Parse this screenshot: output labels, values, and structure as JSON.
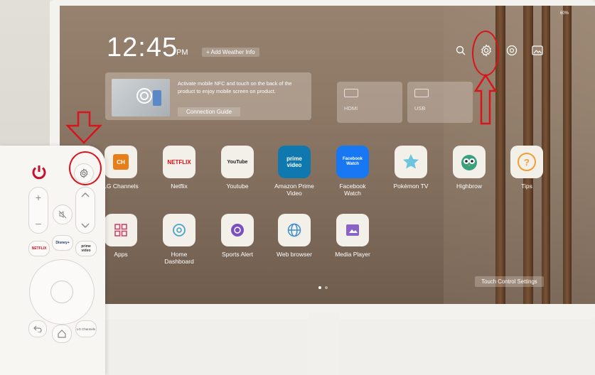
{
  "status": {
    "battery": "60%"
  },
  "home": {
    "time": "12:45",
    "ampm": "PM",
    "weather_button": "+ Add Weather Info",
    "nfc": {
      "text": "Activate mobile NFC and touch on the back of the product to enjoy mobile screen on product.",
      "button": "Connection Guide"
    },
    "inputs": [
      {
        "label": "HDMI"
      },
      {
        "label": "USB"
      }
    ],
    "top_icons": [
      "search-icon",
      "settings-icon",
      "account-icon",
      "gallery-icon"
    ],
    "apps_row1": [
      {
        "label": "LG Channels",
        "tile_text": "CH"
      },
      {
        "label": "Netflix",
        "tile_text": "NETFLIX"
      },
      {
        "label": "Youtube",
        "tile_text": "YouTube"
      },
      {
        "label": "Amazon Prime Video",
        "tile_text": "prime video"
      },
      {
        "label": "Facebook Watch",
        "tile_text": "Facebook Watch"
      },
      {
        "label": "Pokémon TV",
        "tile_text": ""
      },
      {
        "label": "Highbrow",
        "tile_text": ""
      },
      {
        "label": "Tips",
        "tile_text": "?"
      }
    ],
    "apps_row2": [
      {
        "label": "Apps"
      },
      {
        "label": "Home Dashboard"
      },
      {
        "label": "Sports Alert"
      },
      {
        "label": "Web browser"
      },
      {
        "label": "Media Player"
      }
    ],
    "touch_button": "Touch Control Settings"
  },
  "remote": {
    "netflix": "NETFLIX",
    "disney": "Disney+",
    "prime": "prime video",
    "lg_channels": "LG Channels"
  },
  "colors": {
    "annotation": "#d8141c",
    "netflix_red": "#e50914",
    "power_red": "#c8102e"
  }
}
